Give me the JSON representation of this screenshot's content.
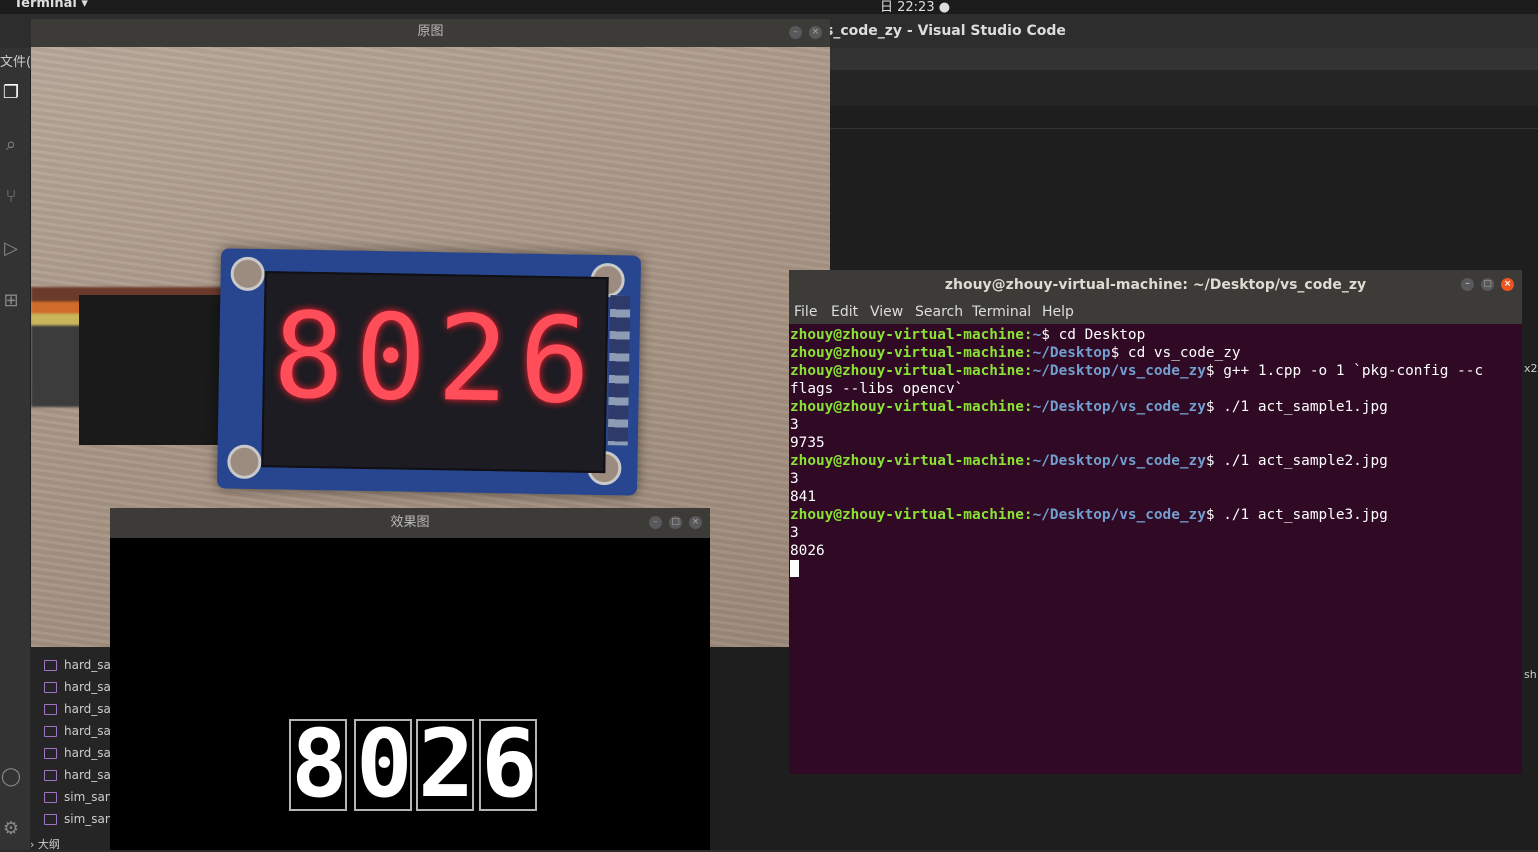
{
  "topbar": {
    "app": "Terminal ▾",
    "clock": "日 22:23 ●"
  },
  "vscode": {
    "title": "s_code_zy - Visual Studio Code",
    "menu_fragment": "文件(F",
    "files": [
      "hard_sa",
      "hard_sa",
      "hard_sa",
      "hard_sa",
      "hard_sa",
      "hard_sa",
      "sim_san",
      "sim_san"
    ],
    "outline": "› 大纲",
    "right_text": [
      "x2",
      "sh"
    ]
  },
  "orig_window": {
    "title": "原图",
    "digits": [
      "8",
      "0",
      "2",
      "6"
    ]
  },
  "effect_window": {
    "title": "效果图",
    "digits": [
      "8",
      "0",
      "2",
      "6"
    ]
  },
  "terminal": {
    "title": "zhouy@zhouy-virtual-machine: ~/Desktop/vs_code_zy",
    "menu": [
      "File",
      "Edit",
      "View",
      "Search",
      "Terminal",
      "Help"
    ],
    "lines": [
      {
        "user": "zhouy@zhouy-virtual-machine",
        "path": "~",
        "cmd": "$ cd Desktop"
      },
      {
        "user": "zhouy@zhouy-virtual-machine",
        "path": "~/Desktop",
        "cmd": "$ cd vs_code_zy"
      },
      {
        "user": "zhouy@zhouy-virtual-machine",
        "path": "~/Desktop/vs_code_zy",
        "cmd": "$ g++ 1.cpp -o 1 `pkg-config --c"
      },
      {
        "text": "flags --libs opencv`"
      },
      {
        "user": "zhouy@zhouy-virtual-machine",
        "path": "~/Desktop/vs_code_zy",
        "cmd": "$ ./1 act_sample1.jpg"
      },
      {
        "text": "3"
      },
      {
        "text": "9735"
      },
      {
        "user": "zhouy@zhouy-virtual-machine",
        "path": "~/Desktop/vs_code_zy",
        "cmd": "$ ./1 act_sample2.jpg"
      },
      {
        "text": "3"
      },
      {
        "text": "841"
      },
      {
        "user": "zhouy@zhouy-virtual-machine",
        "path": "~/Desktop/vs_code_zy",
        "cmd": "$ ./1 act_sample3.jpg"
      },
      {
        "text": "3"
      },
      {
        "text": "8026"
      }
    ]
  },
  "colors": {
    "terminal_bg": "#300a24",
    "user_green": "#8ae234",
    "path_blue": "#729fcf",
    "led_red": "#ff4d5a"
  }
}
